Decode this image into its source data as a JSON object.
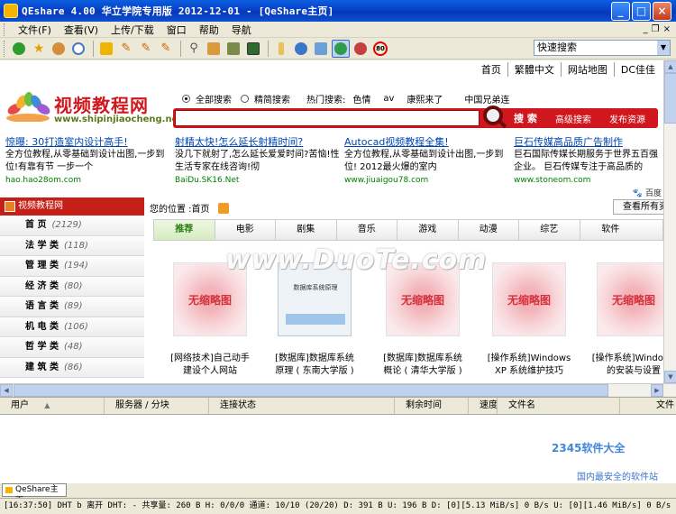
{
  "window": {
    "title": "QEshare 4.00 华立学院专用版 2012-12-01 - [QeShare主页]"
  },
  "menu": [
    "文件(F)",
    "查看(V)",
    "上传/下载",
    "窗口",
    "帮助",
    "导航"
  ],
  "toolbar": {
    "quick_search": "快速搜索",
    "icons": [
      "refresh-icon",
      "star-icon",
      "users-icon",
      "clock-icon",
      "download-icon",
      "edit-icon",
      "edit-icon",
      "edit-icon",
      "search-icon",
      "bookmark-icon",
      "share-icon",
      "monitor-icon",
      "pencil-icon",
      "globe-icon",
      "user-icon",
      "world-icon",
      "tools-icon",
      "speed-icon"
    ],
    "speed_value": "80"
  },
  "web": {
    "topnav": [
      "首页",
      "繁體中文",
      "网站地图",
      "DC佳佳"
    ],
    "logo": {
      "brand": "视频教程网",
      "url": "www.shipinjiaocheng.net"
    },
    "search": {
      "option_all": "全部搜索",
      "option_exact": "精简搜索",
      "hot_label": "热门搜索:",
      "hot": [
        "色情",
        "av",
        "康熙来了",
        "中国兄弟连"
      ],
      "search_btn": "搜 索",
      "advanced": "高级搜索",
      "publish": "发布资源"
    },
    "ads": [
      {
        "title": "惊曝: 30打造室内设计高手!",
        "desc": "全方位教程,从零基础到设计出图,一步到位!有靠有节 一步一个",
        "url": "hao.hao28om.com"
      },
      {
        "title": "射精太快!怎么延长射精时间?",
        "desc": "没几下就射了,怎么延长爱爱时间?苦恼!性生活专家在线咨询!彻",
        "url": "BaiDu.SK16.Net"
      },
      {
        "title": "Autocad视频教程全集!",
        "desc": "全方位教程,从零基础到设计出图,一步到位! 2012最火爆的室内",
        "url": "www.jiuaigou78.com"
      },
      {
        "title": "巨石传媒高品质广告制作",
        "desc": "巨石国际传媒长期服务于世界五百强企业。 巨石传媒专注于高品质的",
        "url": "www.stoneom.com"
      }
    ],
    "baidu": "百度",
    "leftnav": {
      "header": "视频教程网",
      "items": [
        {
          "name": "首 页",
          "count": "(2129)"
        },
        {
          "name": "法 学 类",
          "count": "(118)"
        },
        {
          "name": "管 理 类",
          "count": "(194)"
        },
        {
          "name": "经 济 类",
          "count": "(80)"
        },
        {
          "name": "语 言 类",
          "count": "(89)"
        },
        {
          "name": "机 电 类",
          "count": "(106)"
        },
        {
          "name": "哲 学 类",
          "count": "(48)"
        },
        {
          "name": "建 筑 类",
          "count": "(86)"
        }
      ]
    },
    "breadcrumb": "您的位置 :首页",
    "view_all": "查看所有资",
    "tabs": [
      "推荐",
      "电影",
      "剧集",
      "音乐",
      "游戏",
      "动漫",
      "综艺",
      "软件"
    ],
    "active_tab": "推荐",
    "thumbnails": [
      {
        "placeholder": "无缩略图",
        "caption": "[网络技术]自己动手建设个人网站"
      },
      {
        "placeholder": "数据库系统原理",
        "caption": "[数据库]数据库系统原理 ( 东南大学版 )"
      },
      {
        "placeholder": "无缩略图",
        "caption": "[数据库]数据库系统概论 ( 清华大学版 )"
      },
      {
        "placeholder": "无缩略图",
        "caption": "[操作系统]Windows XP 系统维护技巧"
      },
      {
        "placeholder": "无缩略图",
        "caption": "[操作系统]Windows 的安装与设置"
      }
    ],
    "watermark": "www.DuoTe.com"
  },
  "transfers": {
    "columns": [
      "用户",
      "服务器 / 分块",
      "连接状态",
      "剩余时间",
      "速度",
      "文件名",
      "文件"
    ],
    "logo": "2345软件大全",
    "logo_sub": "国内最安全的软件站"
  },
  "doc_tab": "QeShare主页",
  "status": "[16:37:50] DHT b 离开  DHT: - 共享量: 260 B  H: 0/0/0  通道: 10/10 (20/20)  D: 391 B  U: 196 B  D: [0][5.13 MiB/s] 0 B/s  U: [0][1.46 MiB/s] 0 B/s"
}
